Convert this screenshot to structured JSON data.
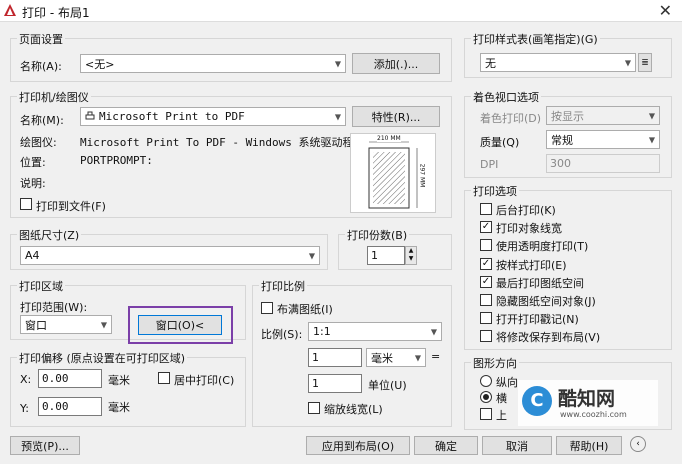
{
  "window": {
    "title": "打印 - 布局1",
    "close": "✕"
  },
  "page_setup": {
    "group": "页面设置",
    "name_label": "名称(A):",
    "name_value": "<无>",
    "add_button": "添加(.)..."
  },
  "printer": {
    "group": "打印机/绘图仪",
    "name_label": "名称(M):",
    "name_value": "Microsoft Print to PDF",
    "properties_button": "特性(R)...",
    "plotter_label": "绘图仪:",
    "plotter_value": "Microsoft Print To PDF - Windows 系统驱动程...",
    "location_label": "位置:",
    "location_value": "PORTPROMPT:",
    "description_label": "说明:",
    "print_to_file": "打印到文件(F)",
    "preview_width": "210 MM",
    "preview_height": "297 MM"
  },
  "paper_size": {
    "group": "图纸尺寸(Z)",
    "value": "A4"
  },
  "copies": {
    "group": "打印份数(B)",
    "value": "1"
  },
  "plot_area": {
    "group": "打印区域",
    "range_label": "打印范围(W):",
    "range_value": "窗口",
    "window_button": "窗口(O)<"
  },
  "plot_offset": {
    "group": "打印偏移 (原点设置在可打印区域)",
    "x_label": "X:",
    "x_value": "0.00",
    "x_unit": "毫米",
    "y_label": "Y:",
    "y_value": "0.00",
    "y_unit": "毫米",
    "center": "居中打印(C)"
  },
  "plot_scale": {
    "group": "打印比例",
    "fit": "布满图纸(I)",
    "scale_label": "比例(S):",
    "scale_value": "1:1",
    "value1": "1",
    "unit1": "毫米",
    "equals": "=",
    "value2": "1",
    "unit2": "单位(U)",
    "lineweights": "缩放线宽(L)"
  },
  "plot_style": {
    "group": "打印样式表(画笔指定)(G)",
    "value": "无"
  },
  "shaded": {
    "group": "着色视口选项",
    "shade_label": "着色打印(D)",
    "shade_value": "按显示",
    "quality_label": "质量(Q)",
    "quality_value": "常规",
    "dpi_label": "DPI",
    "dpi_value": "300"
  },
  "plot_options": {
    "group": "打印选项",
    "items": [
      {
        "label": "后台打印(K)",
        "checked": false
      },
      {
        "label": "打印对象线宽",
        "checked": true
      },
      {
        "label": "使用透明度打印(T)",
        "checked": false
      },
      {
        "label": "按样式打印(E)",
        "checked": true
      },
      {
        "label": "最后打印图纸空间",
        "checked": true
      },
      {
        "label": "隐藏图纸空间对象(J)",
        "checked": false
      },
      {
        "label": "打开打印戳记(N)",
        "checked": false
      },
      {
        "label": "将修改保存到布局(V)",
        "checked": false
      }
    ]
  },
  "orientation": {
    "group": "图形方向",
    "portrait": "纵向",
    "landscape": "横",
    "upside_down": "上"
  },
  "footer": {
    "preview": "预览(P)...",
    "apply": "应用到布局(O)",
    "ok": "确定",
    "cancel": "取消",
    "help": "帮助(H)"
  },
  "watermark": {
    "name": "酷知网",
    "url": "www.coozhi.com"
  }
}
